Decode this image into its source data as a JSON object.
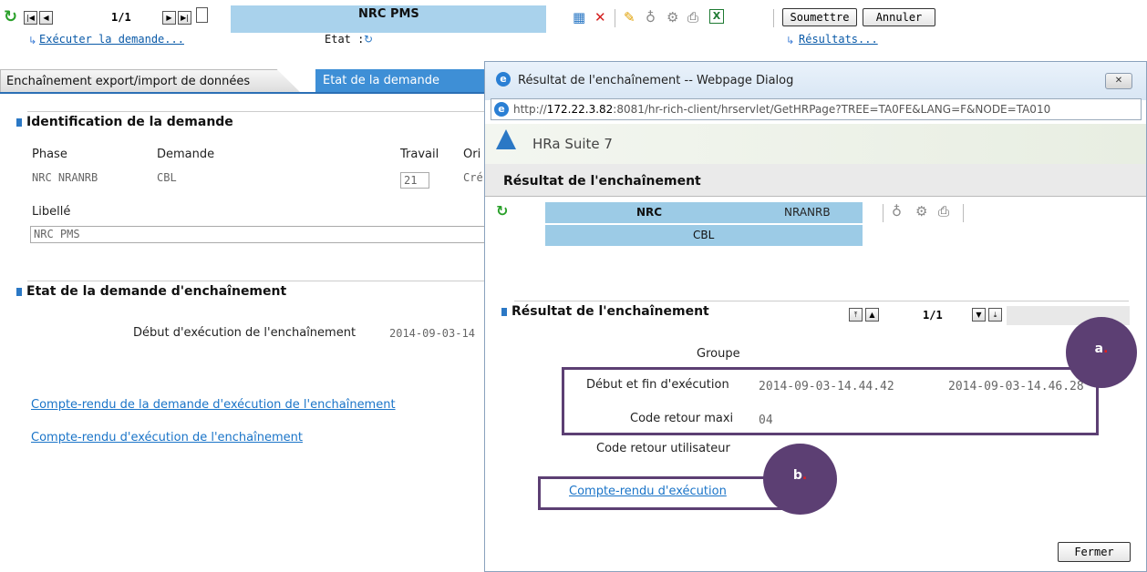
{
  "toolbar": {
    "page_indicator": "1/1",
    "title": "NRC PMS",
    "submit_label": "Soumettre",
    "cancel_label": "Annuler",
    "execute_link": "Exécuter la demande...",
    "state_label": "Etat :",
    "results_link": "Résultats..."
  },
  "tabs": [
    {
      "label": "Enchaînement export/import de données"
    },
    {
      "label": "Etat de la demande"
    }
  ],
  "identification": {
    "title": "Identification de la demande",
    "phase_label": "Phase",
    "demande_label": "Demande",
    "travail_label": "Travail",
    "ori_label": "Ori",
    "phase_value": "NRC  NRANRB",
    "demande_value": "CBL",
    "travail_value": "21",
    "ori_value": "Cré",
    "libelle_label": "Libellé",
    "libelle_value": "NRC PMS"
  },
  "etat": {
    "title": "Etat de la demande d'enchaînement",
    "debut_label": "Début d'exécution de l'enchaînement",
    "debut_value": "2014-09-03-14",
    "link1": "Compte-rendu de la demande d'exécution de l'enchaînement",
    "link2": "Compte-rendu d'exécution de l'enchaînement"
  },
  "dialog": {
    "title": "Résultat de l'enchaînement -- Webpage Dialog",
    "url_host": "172.22.3.82",
    "url_prefix": "http://",
    "url_rest": ":8081/hr-rich-client/hrservlet/GetHRPage?TREE=TA0FE&LANG=F&NODE=TA010",
    "brand": "HRa Suite 7",
    "header_title": "Résultat de l'enchaînement",
    "band_nrc": "NRC",
    "band_nranrb": "NRANRB",
    "band_cbl": "CBL",
    "section_title": "Résultat de l'enchaînement",
    "pager": "1/1",
    "groupe_label": "Groupe",
    "debut_fin_label": "Début et fin d'exécution",
    "debut_value": "2014-09-03-14.44.42",
    "fin_value": "2014-09-03-14.46.28",
    "code_retour_maxi_label": "Code retour maxi",
    "code_retour_maxi_value": "04",
    "code_retour_user_label": "Code retour utilisateur",
    "compte_rendu_link": "Compte-rendu d'exécution",
    "close_label": "Fermer"
  },
  "annotations": {
    "a": "a",
    "b": "b"
  },
  "colors": {
    "accent_blue": "#2b78c5",
    "band_blue": "#9ccbe6",
    "tab_active": "#3e8fd6",
    "annotation_purple": "#5c3f73"
  }
}
